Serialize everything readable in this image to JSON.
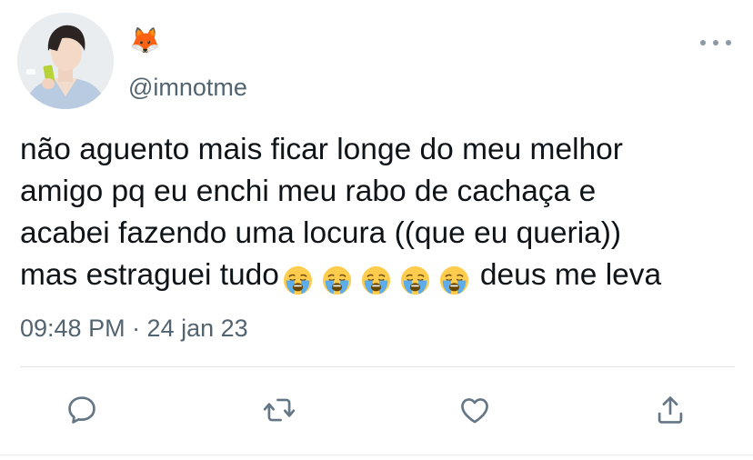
{
  "tweet": {
    "display_name_emoji": "🦊",
    "handle": "@imnotme",
    "text": {
      "line1": "não aguento mais ficar longe do meu melhor",
      "line2": "amigo pq eu enchi meu rabo de cachaça e",
      "line3": "acabei fazendo uma locura ((que eu queria))",
      "line4_before": "mas estraguei tudo",
      "line4_after": "deus me leva",
      "emoji_name": "loudly-crying-face",
      "emoji_count": 5
    },
    "timestamp": "09:48 PM · 24 jan 23"
  },
  "actions": {
    "icons": [
      "reply-icon",
      "retweet-icon",
      "like-icon",
      "share-icon"
    ]
  },
  "colors": {
    "secondary_text": "#536471",
    "icon": "#657786",
    "divider": "#dfe3e6"
  }
}
